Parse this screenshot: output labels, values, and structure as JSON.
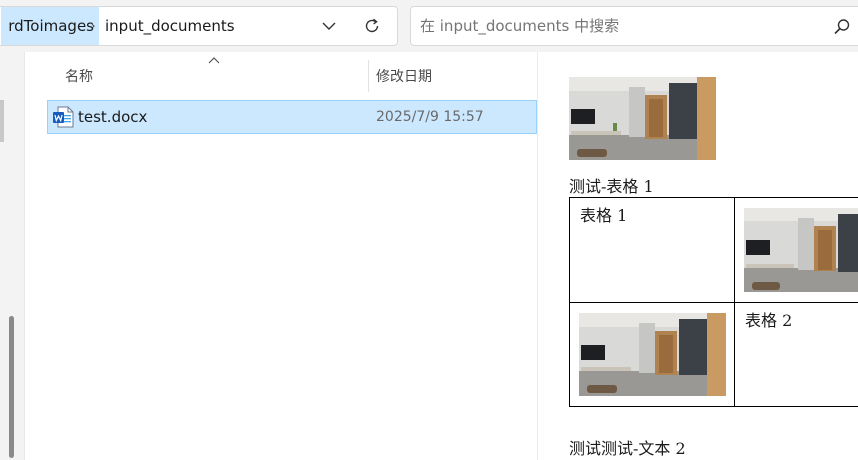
{
  "address_bar": {
    "prev_crumb": "rdToimages",
    "separator": "›",
    "current_crumb": "input_documents",
    "dropdown_icon": "chevron-down-icon",
    "refresh_icon": "refresh-icon"
  },
  "search": {
    "placeholder": "在 input_documents 中搜索",
    "icon": "search-icon"
  },
  "file_list": {
    "columns": {
      "name": "名称",
      "date_modified": "修改日期"
    },
    "sort": "ascending",
    "files": [
      {
        "name": "test.docx",
        "date_modified": "2025/7/9 15:57",
        "icon": "word-document-icon",
        "selected": true
      }
    ]
  },
  "preview": {
    "caption_table": "测试-表格 1",
    "table": {
      "cell_1_text": "表格 1",
      "cell_4_text": "表格 2"
    },
    "bottom_text": "测试测试-文本 2"
  },
  "colors": {
    "selection_bg": "#cce8ff",
    "selection_border": "#99d1ff",
    "chrome_bg": "#f3f3f3"
  }
}
